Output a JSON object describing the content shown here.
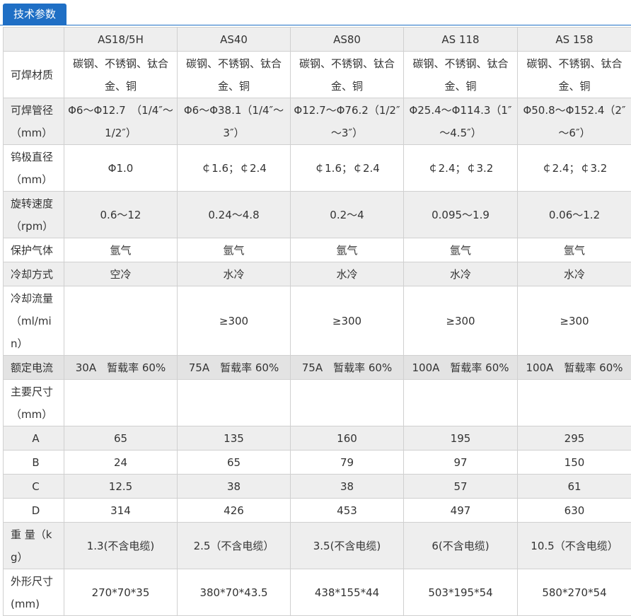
{
  "header": {
    "tab_label": "技术参数"
  },
  "table": {
    "columns": [
      "",
      "AS18/5H",
      "AS40",
      "AS80",
      "AS 118",
      "AS 158"
    ],
    "rows": [
      {
        "label": "可焊材质",
        "cells": [
          "碳钢、不锈钢、钛合金、铜",
          "碳钢、不锈钢、钛合金、铜",
          "碳钢、不锈钢、钛合金、铜",
          "碳钢、不锈钢、钛合金、铜",
          "碳钢、不锈钢、钛合金、铜"
        ]
      },
      {
        "label": "可焊管径（mm）",
        "cells": [
          "Φ6～Φ12.7　（1/4″～1/2″）",
          "Φ6～Φ38.1（1/4″～3″）",
          "Φ12.7～Φ76.2（1/2″～3″）",
          "Φ25.4～Φ114.3（1″～4.5″）",
          "Φ50.8～Φ152.4（2″～6″）"
        ]
      },
      {
        "label": "钨极直径（mm）",
        "cells": [
          "Φ1.0",
          "￠1.6；￠2.4",
          "￠1.6；￠2.4",
          "￠2.4；￠3.2",
          "￠2.4；￠3.2"
        ]
      },
      {
        "label": "旋转速度（rpm）",
        "cells": [
          "0.6～12",
          "0.24～4.8",
          "0.2～4",
          "0.095～1.9",
          "0.06～1.2"
        ]
      },
      {
        "label": "保护气体",
        "cells": [
          "氩气",
          "氩气",
          "氩气",
          "氩气",
          "氩气"
        ]
      },
      {
        "label": "冷却方式",
        "cells": [
          "空冷",
          "水冷",
          "水冷",
          "水冷",
          "水冷"
        ]
      },
      {
        "label": "冷却流量（ml/min）",
        "cells": [
          "",
          "≥300",
          "≥300",
          "≥300",
          "≥300"
        ]
      },
      {
        "label": "额定电流",
        "cells": [
          "30A　暂载率 60%",
          "75A　暂载率 60%",
          "75A　暂载率 60%",
          "100A　暂载率 60%",
          "100A　暂载率 60%"
        ]
      },
      {
        "label": "主要尺寸（mm）",
        "cells": [
          "",
          "",
          "",
          "",
          ""
        ]
      },
      {
        "label": "A",
        "cells": [
          "65",
          "135",
          "160",
          "195",
          "295"
        ]
      },
      {
        "label": "B",
        "cells": [
          "24",
          "65",
          "79",
          "97",
          "150"
        ]
      },
      {
        "label": "C",
        "cells": [
          "12.5",
          "38",
          "38",
          "57",
          "61"
        ]
      },
      {
        "label": "D",
        "cells": [
          "314",
          "426",
          "453",
          "497",
          "630"
        ]
      },
      {
        "label": "重 量（kg）",
        "cells": [
          "1.3(不含电缆)",
          "2.5（不含电缆）",
          "3.5(不含电缆)",
          "6(不含电缆)",
          "10.5（不含电缆）"
        ]
      },
      {
        "label": "外形尺寸(mm)",
        "cells": [
          "270*70*35",
          "380*70*43.5",
          "438*155*44",
          "503*195*54",
          "580*270*54"
        ]
      }
    ]
  }
}
